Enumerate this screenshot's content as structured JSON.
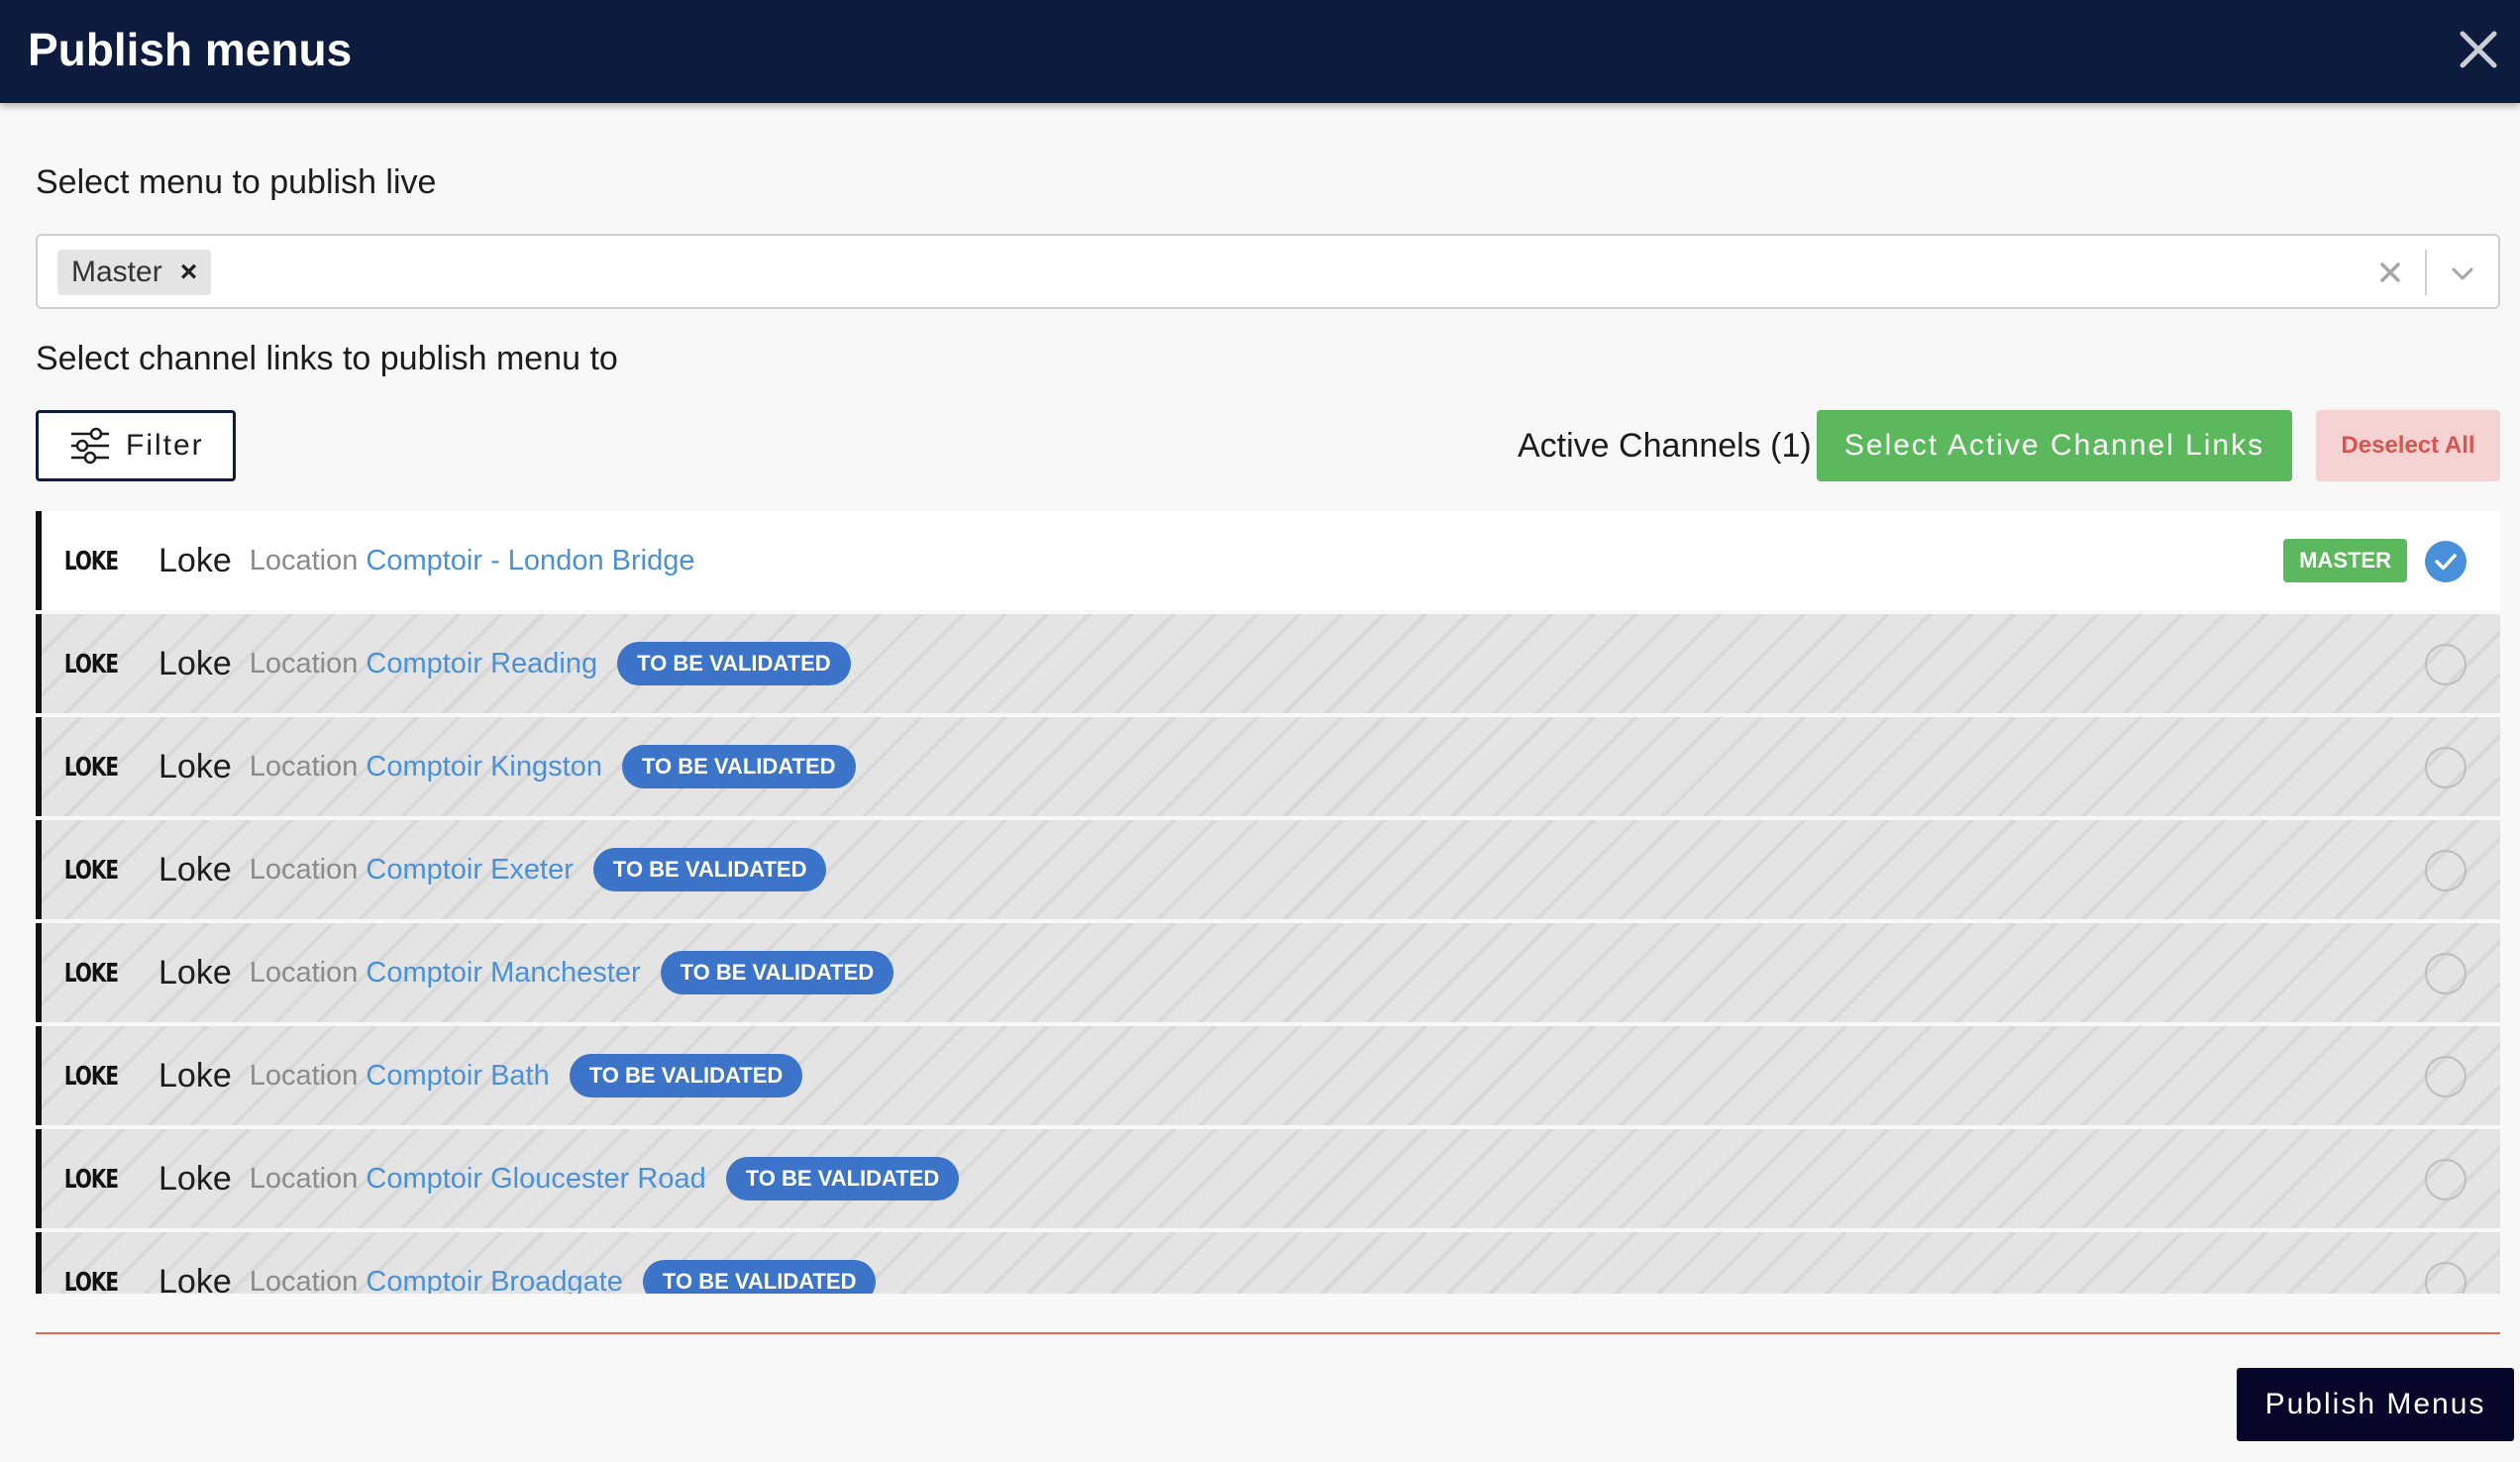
{
  "header": {
    "title": "Publish menus",
    "close_icon": "close-icon"
  },
  "menu_select": {
    "label": "Select menu to publish live",
    "selected_chip": "Master",
    "chip_remove": "×"
  },
  "channels": {
    "label": "Select channel links to publish menu to",
    "filter_label": "Filter",
    "active_count": "Active Channels (1)",
    "select_active_label": "Select Active Channel Links",
    "deselect_all_label": "Deselect All",
    "location_word": "Location",
    "items": [
      {
        "logo": "LOKE",
        "brand": "Loke",
        "location": "Comptoir - London Bridge",
        "badge": "",
        "master": "MASTER",
        "selected": true
      },
      {
        "logo": "LOKE",
        "brand": "Loke",
        "location": "Comptoir Reading",
        "badge": "TO BE VALIDATED",
        "master": "",
        "selected": false
      },
      {
        "logo": "LOKE",
        "brand": "Loke",
        "location": "Comptoir Kingston",
        "badge": "TO BE VALIDATED",
        "master": "",
        "selected": false
      },
      {
        "logo": "LOKE",
        "brand": "Loke",
        "location": "Comptoir Exeter",
        "badge": "TO BE VALIDATED",
        "master": "",
        "selected": false
      },
      {
        "logo": "LOKE",
        "brand": "Loke",
        "location": "Comptoir Manchester",
        "badge": "TO BE VALIDATED",
        "master": "",
        "selected": false
      },
      {
        "logo": "LOKE",
        "brand": "Loke",
        "location": "Comptoir Bath",
        "badge": "TO BE VALIDATED",
        "master": "",
        "selected": false
      },
      {
        "logo": "LOKE",
        "brand": "Loke",
        "location": "Comptoir Gloucester Road",
        "badge": "TO BE VALIDATED",
        "master": "",
        "selected": false
      },
      {
        "logo": "LOKE",
        "brand": "Loke",
        "location": "Comptoir Broadgate",
        "badge": "TO BE VALIDATED",
        "master": "",
        "selected": false
      }
    ]
  },
  "footer": {
    "publish_label": "Publish Menus"
  },
  "colors": {
    "header_bg": "#0d1b3e",
    "success": "#5cb85c",
    "danger": "#d9534f",
    "link": "#4a90d9",
    "badge_blue": "#3b74c9",
    "footer_line": "#e8694a"
  }
}
